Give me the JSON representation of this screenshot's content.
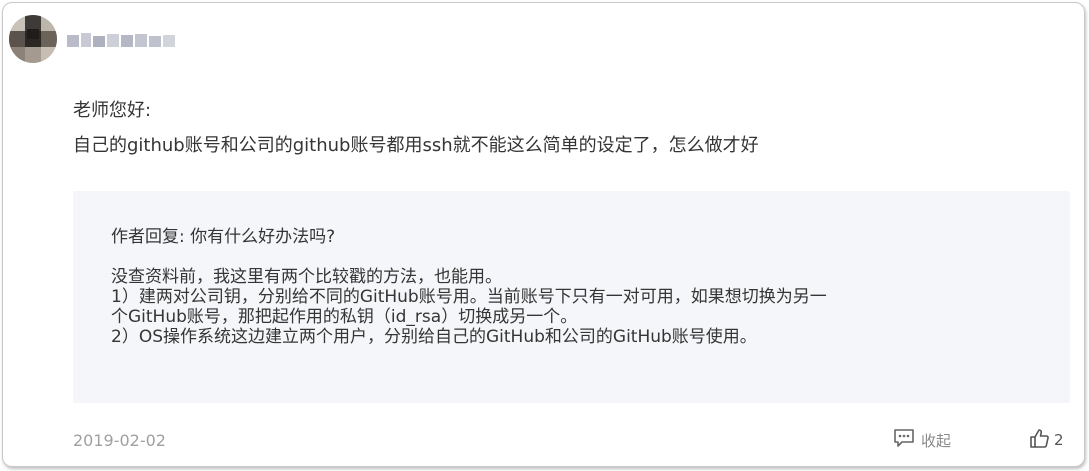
{
  "comment": {
    "greeting": "老师您好:",
    "body": "自己的github账号和公司的github账号都用ssh就不能这么简单的设定了，怎么做才好",
    "date": "2019-02-02"
  },
  "reply": {
    "header": "作者回复: 你有什么好办法吗?",
    "lines": [
      "没查资料前，我这里有两个比较戳的方法，也能用。",
      "1）建两对公司钥，分别给不同的GitHub账号用。当前账号下只有一对可用，如果想切换为另一",
      "个GitHub账号，那把起作用的私钥（id_rsa）切换成另一个。",
      "2）OS操作系统这边建立两个用户，分别给自己的GitHub和公司的GitHub账号使用。"
    ]
  },
  "actions": {
    "collapse_label": "收起",
    "collapse_icon": "comment-collapse-icon",
    "like_icon": "thumbs-up-icon",
    "like_count": "2"
  },
  "colors": {
    "text": "#353535",
    "muted": "#a0a0a0",
    "reply_bg": "#f5f6f9"
  }
}
